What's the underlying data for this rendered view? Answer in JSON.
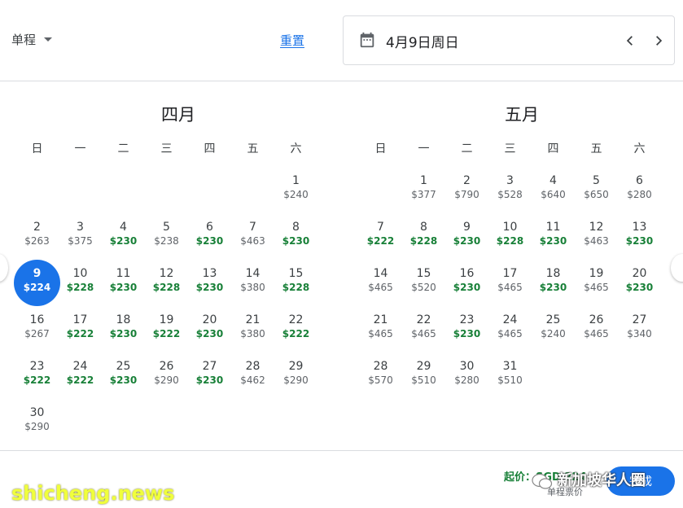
{
  "header": {
    "trip_type": "单程",
    "reset_label": "重置",
    "selected_date": "4月9日周日"
  },
  "weekdays": [
    "日",
    "一",
    "二",
    "三",
    "四",
    "五",
    "六"
  ],
  "months": [
    {
      "title": "四月",
      "first_weekday": 6,
      "days": [
        {
          "d": "1",
          "p": "$240",
          "low": false
        },
        {
          "d": "2",
          "p": "$263",
          "low": false
        },
        {
          "d": "3",
          "p": "$375",
          "low": false
        },
        {
          "d": "4",
          "p": "$230",
          "low": true
        },
        {
          "d": "5",
          "p": "$238",
          "low": false
        },
        {
          "d": "6",
          "p": "$230",
          "low": true
        },
        {
          "d": "7",
          "p": "$463",
          "low": false
        },
        {
          "d": "8",
          "p": "$230",
          "low": true
        },
        {
          "d": "9",
          "p": "$224",
          "low": true,
          "selected": true
        },
        {
          "d": "10",
          "p": "$228",
          "low": true
        },
        {
          "d": "11",
          "p": "$230",
          "low": true
        },
        {
          "d": "12",
          "p": "$228",
          "low": true
        },
        {
          "d": "13",
          "p": "$230",
          "low": true
        },
        {
          "d": "14",
          "p": "$380",
          "low": false
        },
        {
          "d": "15",
          "p": "$228",
          "low": true
        },
        {
          "d": "16",
          "p": "$267",
          "low": false
        },
        {
          "d": "17",
          "p": "$222",
          "low": true
        },
        {
          "d": "18",
          "p": "$230",
          "low": true
        },
        {
          "d": "19",
          "p": "$222",
          "low": true
        },
        {
          "d": "20",
          "p": "$230",
          "low": true
        },
        {
          "d": "21",
          "p": "$380",
          "low": false
        },
        {
          "d": "22",
          "p": "$222",
          "low": true
        },
        {
          "d": "23",
          "p": "$222",
          "low": true
        },
        {
          "d": "24",
          "p": "$222",
          "low": true
        },
        {
          "d": "25",
          "p": "$230",
          "low": true
        },
        {
          "d": "26",
          "p": "$290",
          "low": false
        },
        {
          "d": "27",
          "p": "$230",
          "low": true
        },
        {
          "d": "28",
          "p": "$462",
          "low": false
        },
        {
          "d": "29",
          "p": "$290",
          "low": false
        },
        {
          "d": "30",
          "p": "$290",
          "low": false
        }
      ]
    },
    {
      "title": "五月",
      "first_weekday": 1,
      "days": [
        {
          "d": "1",
          "p": "$377",
          "low": false
        },
        {
          "d": "2",
          "p": "$790",
          "low": false
        },
        {
          "d": "3",
          "p": "$528",
          "low": false
        },
        {
          "d": "4",
          "p": "$640",
          "low": false
        },
        {
          "d": "5",
          "p": "$650",
          "low": false
        },
        {
          "d": "6",
          "p": "$280",
          "low": false
        },
        {
          "d": "7",
          "p": "$222",
          "low": true
        },
        {
          "d": "8",
          "p": "$228",
          "low": true
        },
        {
          "d": "9",
          "p": "$230",
          "low": true
        },
        {
          "d": "10",
          "p": "$228",
          "low": true
        },
        {
          "d": "11",
          "p": "$230",
          "low": true
        },
        {
          "d": "12",
          "p": "$463",
          "low": false
        },
        {
          "d": "13",
          "p": "$230",
          "low": true
        },
        {
          "d": "14",
          "p": "$465",
          "low": false
        },
        {
          "d": "15",
          "p": "$520",
          "low": false
        },
        {
          "d": "16",
          "p": "$230",
          "low": true
        },
        {
          "d": "17",
          "p": "$465",
          "low": false
        },
        {
          "d": "18",
          "p": "$230",
          "low": true
        },
        {
          "d": "19",
          "p": "$465",
          "low": false
        },
        {
          "d": "20",
          "p": "$230",
          "low": true
        },
        {
          "d": "21",
          "p": "$465",
          "low": false
        },
        {
          "d": "22",
          "p": "$465",
          "low": false
        },
        {
          "d": "23",
          "p": "$230",
          "low": true
        },
        {
          "d": "24",
          "p": "$465",
          "low": false
        },
        {
          "d": "25",
          "p": "$240",
          "low": false
        },
        {
          "d": "26",
          "p": "$465",
          "low": false
        },
        {
          "d": "27",
          "p": "$340",
          "low": false
        },
        {
          "d": "28",
          "p": "$570",
          "low": false
        },
        {
          "d": "29",
          "p": "$510",
          "low": false
        },
        {
          "d": "30",
          "p": "$280",
          "low": false
        },
        {
          "d": "31",
          "p": "$510",
          "low": false
        }
      ]
    }
  ],
  "footer": {
    "from_price": "起价：SGD 224",
    "from_sub": "单程票价",
    "done_label": "完成"
  },
  "watermark": {
    "channel": "新加坡华人圈",
    "site": "shicheng.news"
  },
  "colors": {
    "accent": "#1a73e8",
    "low_price": "#188038",
    "text": "#202124"
  }
}
